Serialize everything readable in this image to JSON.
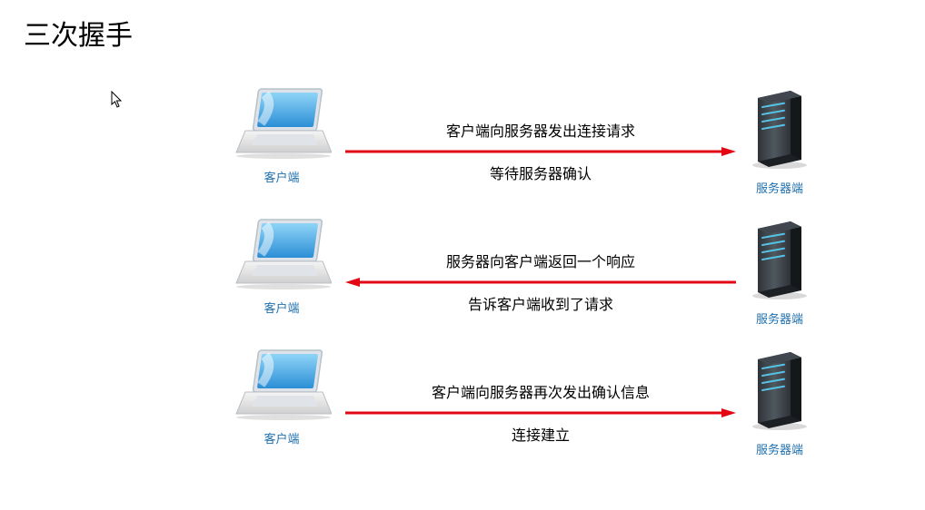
{
  "title": "三次握手",
  "client_label": "客户端",
  "server_label": "服务器端",
  "steps": [
    {
      "top": "客户端向服务器发出连接请求",
      "bottom": "等待服务器确认",
      "direction": "right"
    },
    {
      "top": "服务器向客户端返回一个响应",
      "bottom": "告诉客户端收到了请求",
      "direction": "left"
    },
    {
      "top": "客户端向服务器再次发出确认信息",
      "bottom": "连接建立",
      "direction": "right"
    }
  ]
}
